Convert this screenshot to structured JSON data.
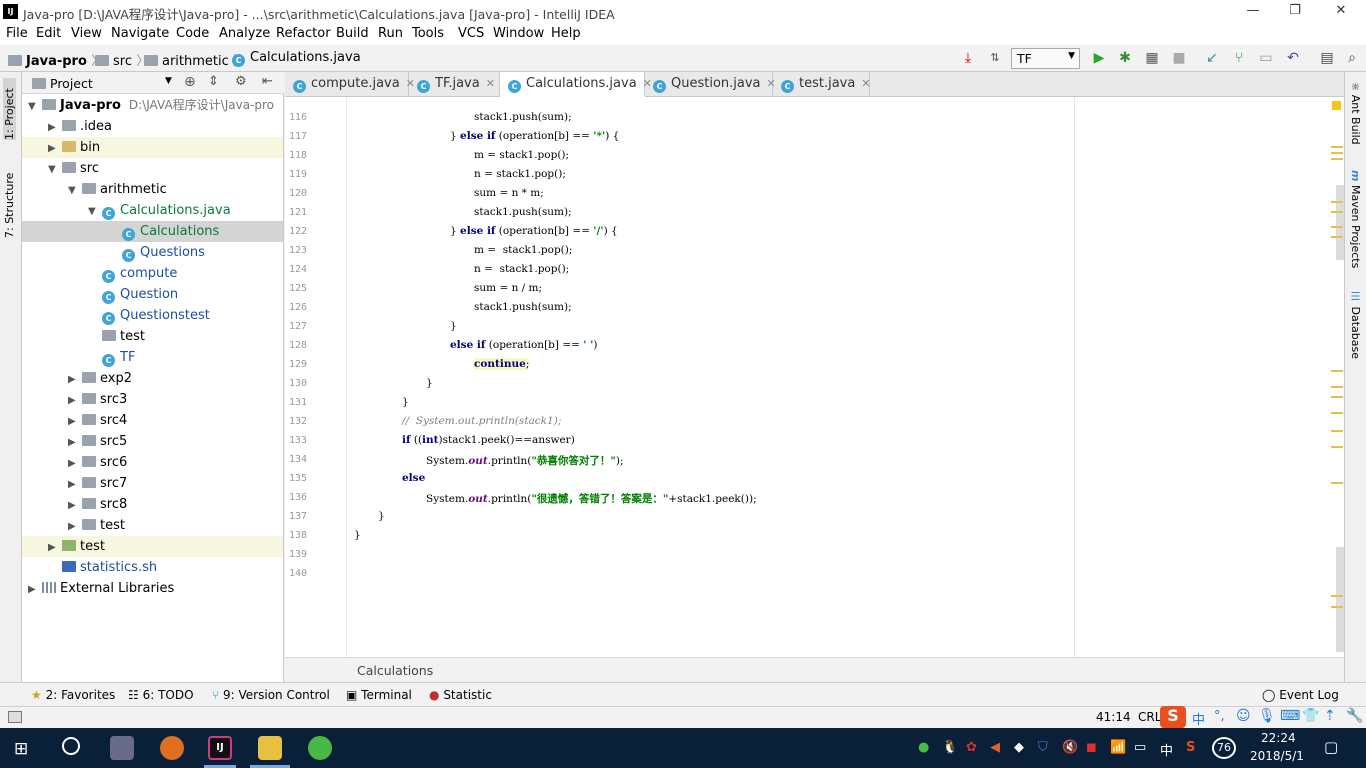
{
  "window": {
    "title": "Java-pro [D:\\JAVA程序设计\\Java-pro] - ...\\src\\arithmetic\\Calculations.java [Java-pro] - IntelliJ IDEA",
    "logo_text": "IJ",
    "min": "—",
    "restore": "❐",
    "close": "✕"
  },
  "menu": [
    "File",
    "Edit",
    "View",
    "Navigate",
    "Code",
    "Analyze",
    "Refactor",
    "Build",
    "Run",
    "Tools",
    "VCS",
    "Window",
    "Help"
  ],
  "breadcrumb": [
    "Java-pro",
    "src",
    "arithmetic",
    "Calculations.java"
  ],
  "run_config": "TF",
  "left_tabs": {
    "project": "1: Project",
    "structure": "7: Structure"
  },
  "right_tabs": {
    "ant": "Ant Build",
    "maven": "Maven Projects",
    "database": "Database"
  },
  "project_panel": {
    "title": "Project",
    "root_name": "Java-pro",
    "root_path": "D:\\JAVA程序设计\\Java-pro",
    "items": [
      {
        "label": "Java-pro",
        "depth": 0,
        "arrow": "▼"
      },
      {
        "label": ".idea",
        "depth": 1,
        "arrow": "▶"
      },
      {
        "label": "bin",
        "depth": 1,
        "arrow": "▶"
      },
      {
        "label": "src",
        "depth": 1,
        "arrow": "▼"
      },
      {
        "label": "arithmetic",
        "depth": 2,
        "arrow": "▼"
      },
      {
        "label": "Calculations.java",
        "depth": 3,
        "arrow": "▼"
      },
      {
        "label": "Calculations",
        "depth": 4,
        "arrow": ""
      },
      {
        "label": "Questions",
        "depth": 4,
        "arrow": ""
      },
      {
        "label": "compute",
        "depth": 3,
        "arrow": ""
      },
      {
        "label": "Question",
        "depth": 3,
        "arrow": ""
      },
      {
        "label": "Questionstest",
        "depth": 3,
        "arrow": ""
      },
      {
        "label": "test",
        "depth": 3,
        "arrow": ""
      },
      {
        "label": "TF",
        "depth": 3,
        "arrow": ""
      },
      {
        "label": "exp2",
        "depth": 2,
        "arrow": "▶"
      },
      {
        "label": "src3",
        "depth": 2,
        "arrow": "▶"
      },
      {
        "label": "src4",
        "depth": 2,
        "arrow": "▶"
      },
      {
        "label": "src5",
        "depth": 2,
        "arrow": "▶"
      },
      {
        "label": "src6",
        "depth": 2,
        "arrow": "▶"
      },
      {
        "label": "src7",
        "depth": 2,
        "arrow": "▶"
      },
      {
        "label": "src8",
        "depth": 2,
        "arrow": "▶"
      },
      {
        "label": "test",
        "depth": 2,
        "arrow": "▶"
      },
      {
        "label": "test",
        "depth": 1,
        "arrow": "▶"
      },
      {
        "label": "statistics.sh",
        "depth": 1,
        "arrow": ""
      },
      {
        "label": "External Libraries",
        "depth": 0,
        "arrow": "▶"
      }
    ]
  },
  "tabs": [
    "compute.java",
    "TF.java",
    "Calculations.java",
    "Question.java",
    "test.java"
  ],
  "active_tab": "Calculations.java",
  "code": {
    "lines": [
      "116",
      "117",
      "118",
      "119",
      "120",
      "121",
      "122",
      "123",
      "124",
      "125",
      "126",
      "127",
      "128",
      "129",
      "130",
      "131",
      "132",
      "133",
      "134",
      "135",
      "136",
      "137",
      "138",
      "139",
      "140"
    ],
    "l116": "stack1.push(sum);",
    "l118": "m = stack1.pop();",
    "l119": "n = stack1.pop();",
    "l120": "sum = n * m;",
    "l121": "stack1.push(sum);",
    "l123": "m =  stack1.pop();",
    "l124": "n =  stack1.pop();",
    "l125": "sum = n / m;",
    "l126": "stack1.push(sum);",
    "l132": "//  System.out.println(stack1);",
    "str_correct": "\"恭喜你答对了！\"",
    "str_wrong": "\"很遗憾，答错了！答案是：\""
  },
  "editor_breadcrumb": "Calculations",
  "toolwindows": [
    "2: Favorites",
    "6: TODO",
    "9: Version Control",
    "Terminal",
    "Statistic",
    "Event Log"
  ],
  "status": {
    "position": "41:14",
    "encoding": "CRL"
  },
  "taskbar": {
    "time": "22:24",
    "date": "2018/5/1",
    "ime": "中",
    "battery": "76"
  }
}
